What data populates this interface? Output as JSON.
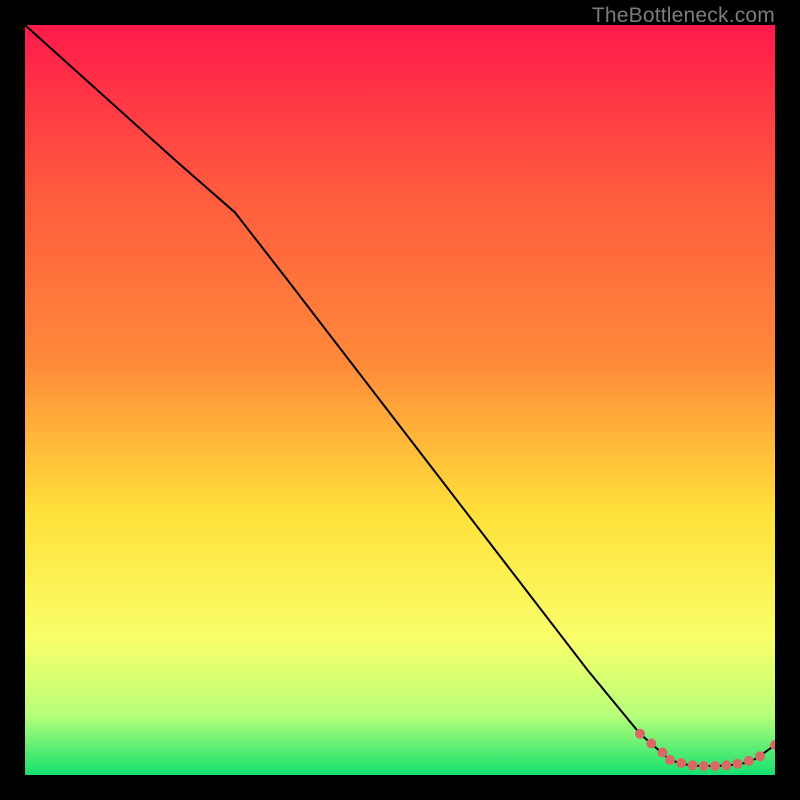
{
  "attribution": "TheBottleneck.com",
  "colors": {
    "page_bg": "#000000",
    "line": "#000000",
    "marker": "#d76a64",
    "gradient_top": "#ff1a4b",
    "gradient_mid_upper": "#ff8a3a",
    "gradient_mid": "#ffe13a",
    "gradient_mid_lower": "#f9ff6a",
    "gradient_lower": "#b8ff7a",
    "gradient_bottom": "#13e06e"
  },
  "chart_data": {
    "type": "line",
    "title": "",
    "xlabel": "",
    "ylabel": "",
    "xlim": [
      0,
      100
    ],
    "ylim": [
      0,
      100
    ],
    "grid": false,
    "legend": false,
    "background": "vertical-gradient red→orange→yellow→green",
    "series": [
      {
        "name": "curve",
        "x": [
          0,
          10,
          20,
          28,
          35,
          45,
          55,
          65,
          75,
          82,
          86,
          88,
          90,
          92,
          94,
          96,
          97.5,
          100
        ],
        "y": [
          100,
          91,
          82,
          75,
          66,
          53,
          40,
          27,
          14,
          5.5,
          2.0,
          1.4,
          1.2,
          1.2,
          1.3,
          1.6,
          2.2,
          4.0
        ],
        "stroke": "#000000",
        "stroke_width": 2
      }
    ],
    "markers": [
      {
        "x": 82.0,
        "y": 5.5
      },
      {
        "x": 83.5,
        "y": 4.2
      },
      {
        "x": 85.0,
        "y": 3.0
      },
      {
        "x": 86.0,
        "y": 2.0
      },
      {
        "x": 87.5,
        "y": 1.6
      },
      {
        "x": 89.0,
        "y": 1.3
      },
      {
        "x": 90.5,
        "y": 1.2
      },
      {
        "x": 92.0,
        "y": 1.2
      },
      {
        "x": 93.5,
        "y": 1.3
      },
      {
        "x": 95.0,
        "y": 1.5
      },
      {
        "x": 96.5,
        "y": 1.9
      },
      {
        "x": 98.0,
        "y": 2.5
      },
      {
        "x": 100.0,
        "y": 4.0
      }
    ]
  }
}
